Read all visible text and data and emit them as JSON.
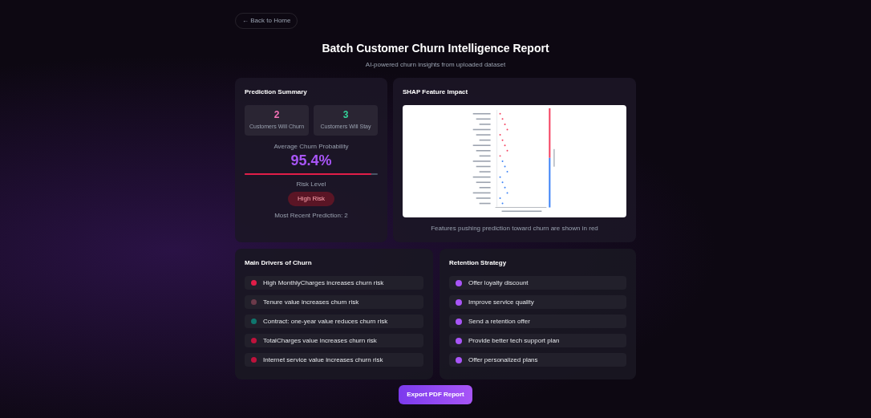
{
  "back_link": "← Back to Home",
  "title": "Batch Customer Churn Intelligence Report",
  "subtitle": "AI-powered churn insights from uploaded dataset",
  "summary": {
    "heading": "Prediction Summary",
    "stats": [
      {
        "value": "2",
        "label": "Customers Will Churn",
        "color": "#f472b6"
      },
      {
        "value": "3",
        "label": "Customers Will Stay",
        "color": "#34d399"
      }
    ],
    "probability_label": "Average Churn Probability",
    "probability": "95.4%",
    "level": 0.954,
    "risk_label": "Risk Level",
    "risk": "High Risk",
    "note": "Most Recent Prediction: 2"
  },
  "shap": {
    "heading": "SHAP Feature Impact",
    "caption": "Features pushing prediction toward churn are shown in red"
  },
  "drivers": {
    "heading": "Main Drivers of Churn",
    "items": [
      {
        "text": "High MonthlyCharges increases churn risk",
        "color": "#e11d48"
      },
      {
        "text": "Tenure value increases churn risk",
        "color": "#6b3a4a"
      },
      {
        "text": "Contract: one-year value reduces churn risk",
        "color": "#0f766e"
      },
      {
        "text": "TotalCharges value increases churn risk",
        "color": "#be123c"
      },
      {
        "text": "Internet service value increases churn risk",
        "color": "#be123c"
      }
    ]
  },
  "strategy": {
    "heading": "Retention Strategy",
    "items": [
      "Offer loyalty discount",
      "Improve service quality",
      "Send a retention offer",
      "Provide better tech support plan",
      "Offer personalized plans"
    ]
  },
  "export_button": "Export PDF Report"
}
